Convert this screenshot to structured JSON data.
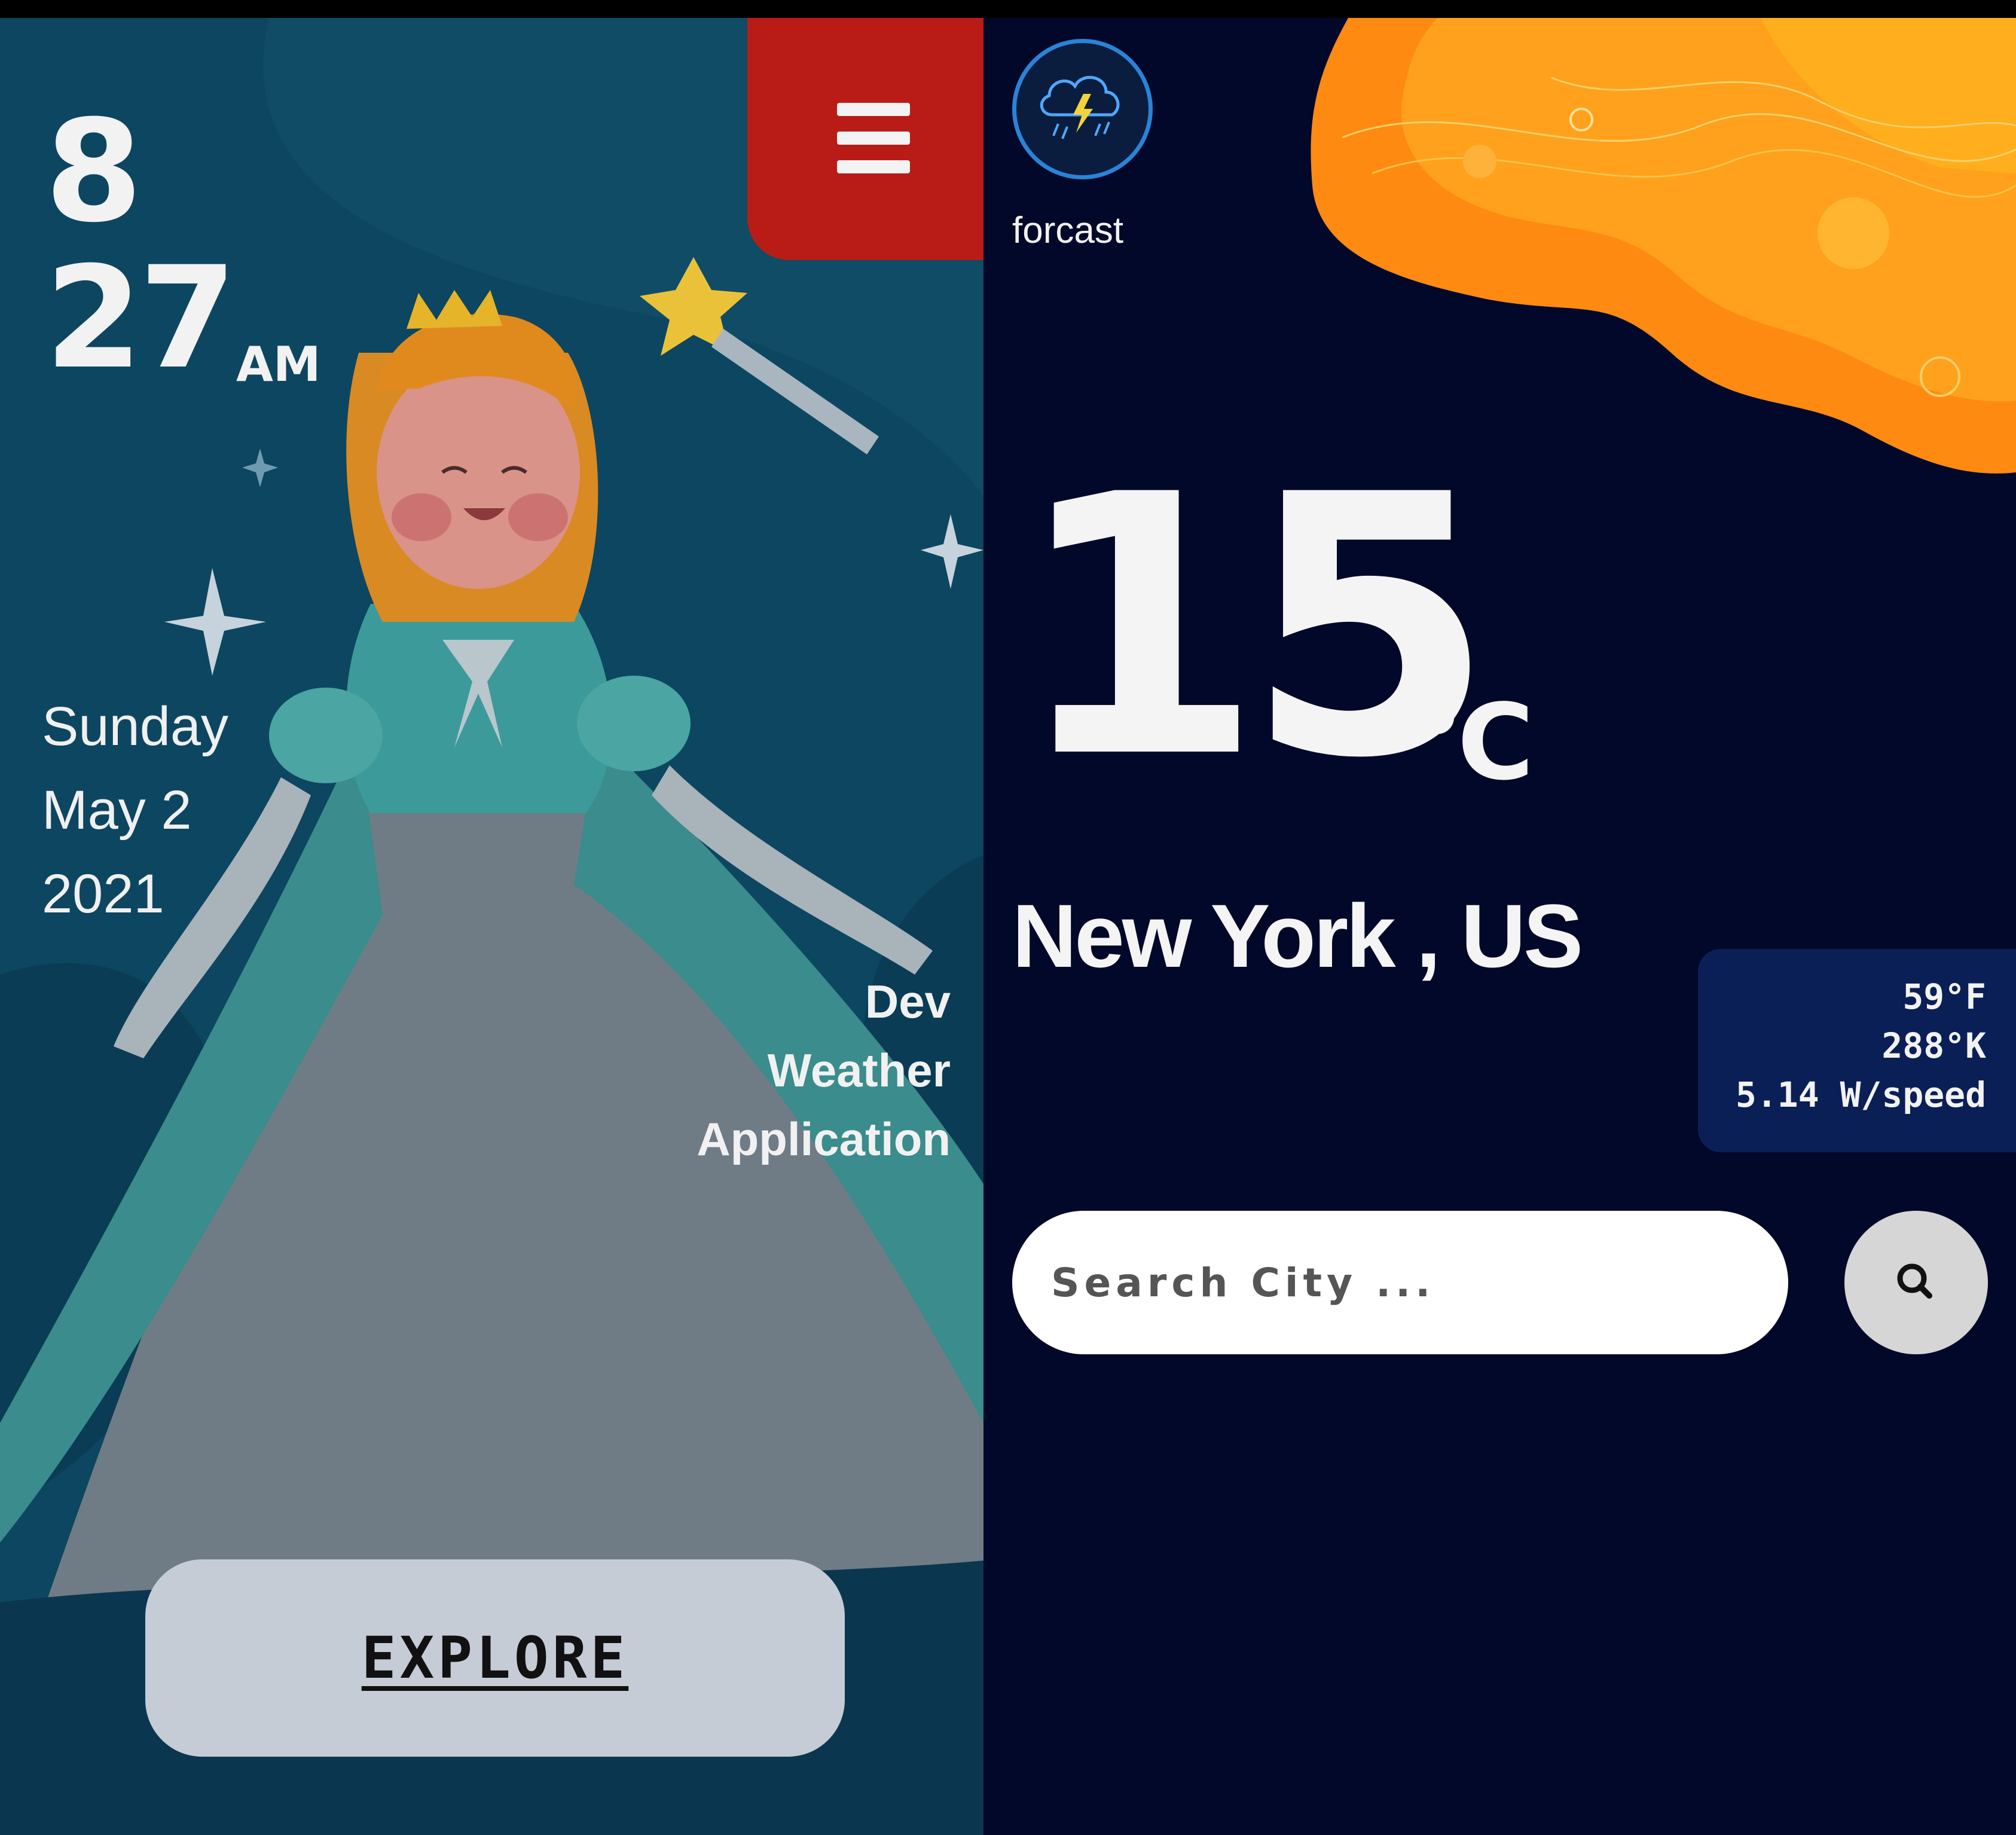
{
  "left_panel": {
    "clock": {
      "hour": "8",
      "minute": "27",
      "period": "AM"
    },
    "date": {
      "weekday": "Sunday",
      "month_day": "May 2",
      "year": "2021"
    },
    "app_name": {
      "line1": "Dev",
      "line2": "Weather",
      "line3": "Application"
    },
    "menu_icon": "hamburger-menu-icon",
    "explore_label": "EXPLORE",
    "colors": {
      "background": "#0d4660",
      "menu": "#b91c17",
      "explore_button": "#c6ccd6"
    }
  },
  "right_panel": {
    "logo_icon": "thunderstorm-cloud-icon",
    "logo_label": "forcast",
    "temperature": {
      "value": "15",
      "unit": "°C"
    },
    "location": "New York , US",
    "stats": {
      "fahrenheit": "59°F",
      "kelvin": "288°K",
      "wind": "5.14 W/speed"
    },
    "search": {
      "placeholder": "Search City ...",
      "value": "",
      "icon": "search-icon"
    },
    "colors": {
      "background": "#020829",
      "accent_blob": "#ff9a1a",
      "stats_card": "#0a1f55"
    }
  }
}
